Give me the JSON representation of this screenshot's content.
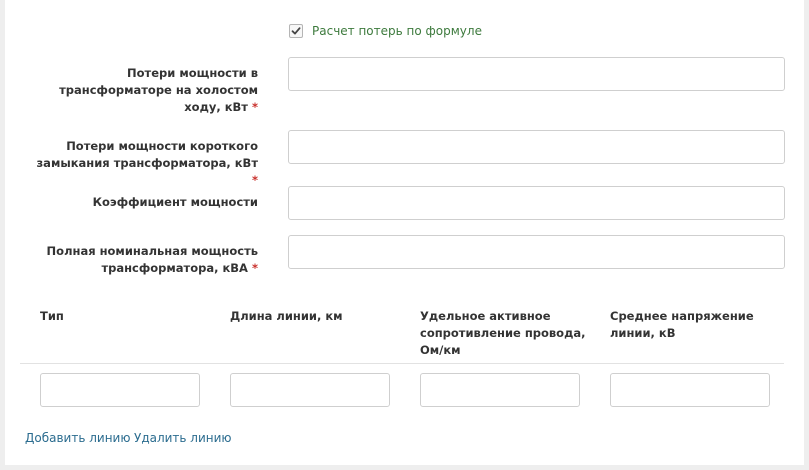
{
  "checkbox": {
    "label": "Расчет потерь по формуле",
    "checked": true
  },
  "fields": [
    {
      "label": "Потери мощности в трансформаторе на холостом ходу, кВт",
      "required": "*",
      "value": ""
    },
    {
      "label": "Потери мощности короткого замыкания трансформатора, кВт",
      "required": "*",
      "value": ""
    },
    {
      "label": "Коэффициент мощности",
      "value": ""
    },
    {
      "label": "Полная номинальная мощность трансформатора, кВА",
      "required": "*",
      "value": ""
    }
  ],
  "table": {
    "headers": [
      "Тип",
      "Длина линии, км",
      "Удельное активное сопротивление провода, Ом/км",
      "Среднее напряжение линии, кВ"
    ],
    "row": [
      "",
      "",
      "",
      ""
    ]
  },
  "actions": {
    "add_line": "Добавить линию",
    "remove_line": "Удалить линию"
  },
  "colors": {
    "required": "#c9302c",
    "link": "#2b6c8f",
    "checkbox_label": "#3d7a3d"
  }
}
